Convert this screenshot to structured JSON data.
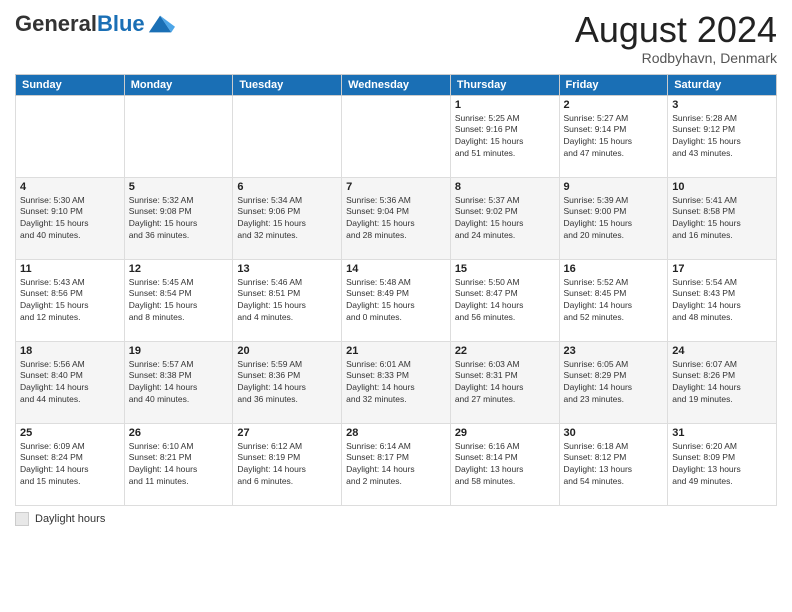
{
  "header": {
    "logo_general": "General",
    "logo_blue": "Blue",
    "month_title": "August 2024",
    "location": "Rodbyhavn, Denmark"
  },
  "footer": {
    "label": "Daylight hours"
  },
  "days_of_week": [
    "Sunday",
    "Monday",
    "Tuesday",
    "Wednesday",
    "Thursday",
    "Friday",
    "Saturday"
  ],
  "weeks": [
    {
      "cells": [
        {
          "day": "",
          "info": ""
        },
        {
          "day": "",
          "info": ""
        },
        {
          "day": "",
          "info": ""
        },
        {
          "day": "",
          "info": ""
        },
        {
          "day": "1",
          "info": "Sunrise: 5:25 AM\nSunset: 9:16 PM\nDaylight: 15 hours\nand 51 minutes."
        },
        {
          "day": "2",
          "info": "Sunrise: 5:27 AM\nSunset: 9:14 PM\nDaylight: 15 hours\nand 47 minutes."
        },
        {
          "day": "3",
          "info": "Sunrise: 5:28 AM\nSunset: 9:12 PM\nDaylight: 15 hours\nand 43 minutes."
        }
      ]
    },
    {
      "cells": [
        {
          "day": "4",
          "info": "Sunrise: 5:30 AM\nSunset: 9:10 PM\nDaylight: 15 hours\nand 40 minutes."
        },
        {
          "day": "5",
          "info": "Sunrise: 5:32 AM\nSunset: 9:08 PM\nDaylight: 15 hours\nand 36 minutes."
        },
        {
          "day": "6",
          "info": "Sunrise: 5:34 AM\nSunset: 9:06 PM\nDaylight: 15 hours\nand 32 minutes."
        },
        {
          "day": "7",
          "info": "Sunrise: 5:36 AM\nSunset: 9:04 PM\nDaylight: 15 hours\nand 28 minutes."
        },
        {
          "day": "8",
          "info": "Sunrise: 5:37 AM\nSunset: 9:02 PM\nDaylight: 15 hours\nand 24 minutes."
        },
        {
          "day": "9",
          "info": "Sunrise: 5:39 AM\nSunset: 9:00 PM\nDaylight: 15 hours\nand 20 minutes."
        },
        {
          "day": "10",
          "info": "Sunrise: 5:41 AM\nSunset: 8:58 PM\nDaylight: 15 hours\nand 16 minutes."
        }
      ]
    },
    {
      "cells": [
        {
          "day": "11",
          "info": "Sunrise: 5:43 AM\nSunset: 8:56 PM\nDaylight: 15 hours\nand 12 minutes."
        },
        {
          "day": "12",
          "info": "Sunrise: 5:45 AM\nSunset: 8:54 PM\nDaylight: 15 hours\nand 8 minutes."
        },
        {
          "day": "13",
          "info": "Sunrise: 5:46 AM\nSunset: 8:51 PM\nDaylight: 15 hours\nand 4 minutes."
        },
        {
          "day": "14",
          "info": "Sunrise: 5:48 AM\nSunset: 8:49 PM\nDaylight: 15 hours\nand 0 minutes."
        },
        {
          "day": "15",
          "info": "Sunrise: 5:50 AM\nSunset: 8:47 PM\nDaylight: 14 hours\nand 56 minutes."
        },
        {
          "day": "16",
          "info": "Sunrise: 5:52 AM\nSunset: 8:45 PM\nDaylight: 14 hours\nand 52 minutes."
        },
        {
          "day": "17",
          "info": "Sunrise: 5:54 AM\nSunset: 8:43 PM\nDaylight: 14 hours\nand 48 minutes."
        }
      ]
    },
    {
      "cells": [
        {
          "day": "18",
          "info": "Sunrise: 5:56 AM\nSunset: 8:40 PM\nDaylight: 14 hours\nand 44 minutes."
        },
        {
          "day": "19",
          "info": "Sunrise: 5:57 AM\nSunset: 8:38 PM\nDaylight: 14 hours\nand 40 minutes."
        },
        {
          "day": "20",
          "info": "Sunrise: 5:59 AM\nSunset: 8:36 PM\nDaylight: 14 hours\nand 36 minutes."
        },
        {
          "day": "21",
          "info": "Sunrise: 6:01 AM\nSunset: 8:33 PM\nDaylight: 14 hours\nand 32 minutes."
        },
        {
          "day": "22",
          "info": "Sunrise: 6:03 AM\nSunset: 8:31 PM\nDaylight: 14 hours\nand 27 minutes."
        },
        {
          "day": "23",
          "info": "Sunrise: 6:05 AM\nSunset: 8:29 PM\nDaylight: 14 hours\nand 23 minutes."
        },
        {
          "day": "24",
          "info": "Sunrise: 6:07 AM\nSunset: 8:26 PM\nDaylight: 14 hours\nand 19 minutes."
        }
      ]
    },
    {
      "cells": [
        {
          "day": "25",
          "info": "Sunrise: 6:09 AM\nSunset: 8:24 PM\nDaylight: 14 hours\nand 15 minutes."
        },
        {
          "day": "26",
          "info": "Sunrise: 6:10 AM\nSunset: 8:21 PM\nDaylight: 14 hours\nand 11 minutes."
        },
        {
          "day": "27",
          "info": "Sunrise: 6:12 AM\nSunset: 8:19 PM\nDaylight: 14 hours\nand 6 minutes."
        },
        {
          "day": "28",
          "info": "Sunrise: 6:14 AM\nSunset: 8:17 PM\nDaylight: 14 hours\nand 2 minutes."
        },
        {
          "day": "29",
          "info": "Sunrise: 6:16 AM\nSunset: 8:14 PM\nDaylight: 13 hours\nand 58 minutes."
        },
        {
          "day": "30",
          "info": "Sunrise: 6:18 AM\nSunset: 8:12 PM\nDaylight: 13 hours\nand 54 minutes."
        },
        {
          "day": "31",
          "info": "Sunrise: 6:20 AM\nSunset: 8:09 PM\nDaylight: 13 hours\nand 49 minutes."
        }
      ]
    }
  ]
}
